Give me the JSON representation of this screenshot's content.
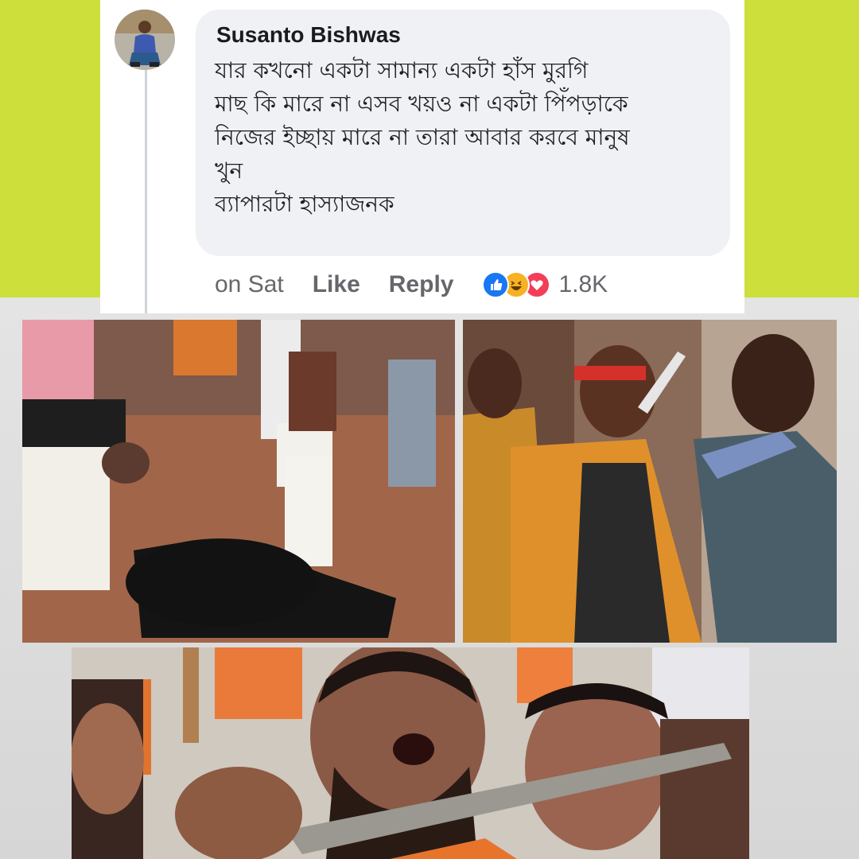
{
  "comment": {
    "author": "Susanto Bishwas",
    "lines": [
      "যার কখনো একটা সামান্য একটা হাঁস মুরগি",
      "মাছ কি মারে না এসব খয়ও না একটা পিঁপড়াকে",
      "নিজের ইচ্ছায় মারে না তারা আবার করবে মানুষ",
      "খুন",
      "ব্যাপারটা হাস্যাজনক"
    ],
    "time": "on Sat",
    "like_label": "Like",
    "reply_label": "Reply",
    "reaction_icons": [
      "like-icon",
      "haha-icon",
      "love-icon"
    ],
    "reaction_count": "1.8K"
  },
  "colors": {
    "top_band": "#cddf3a",
    "bubble": "#eff1f4",
    "reaction_like": "#1877f2",
    "reaction_haha": "#f7b125",
    "reaction_love": "#f33e58"
  },
  "photos": [
    "goat-sacrifice-photo",
    "saffron-scarf-confrontation-photo",
    "machete-crowd-photo"
  ]
}
